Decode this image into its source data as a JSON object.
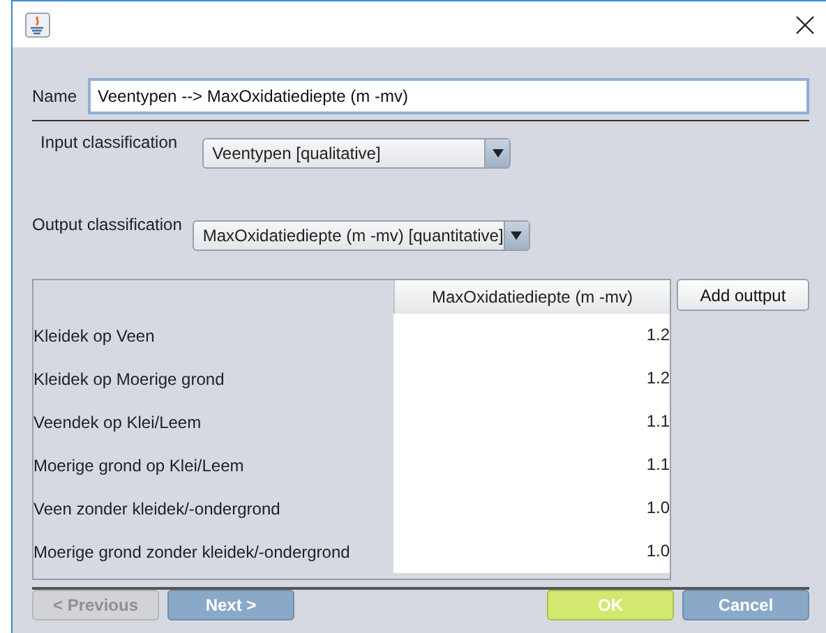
{
  "name_field": {
    "label": "Name",
    "value": "Veentypen --> MaxOxidatiediepte (m -mv)"
  },
  "input_classification": {
    "label": "Input classification",
    "value": "Veentypen [qualitative]"
  },
  "output_classification": {
    "label": "Output classification",
    "value": "MaxOxidatiediepte (m -mv) [quantitative]"
  },
  "table": {
    "columns": [
      "MaxOxidatiediepte (m -mv)"
    ],
    "rows": [
      {
        "label": "Kleidek op Veen",
        "value": "1.2"
      },
      {
        "label": "Kleidek op Moerige grond",
        "value": "1.2"
      },
      {
        "label": "Veendek op Klei/Leem",
        "value": "1.1"
      },
      {
        "label": "Moerige grond op Klei/Leem",
        "value": "1.1"
      },
      {
        "label": "Veen zonder kleidek/-ondergrond",
        "value": "1.0"
      },
      {
        "label": "Moerige grond zonder kleidek/-ondergrond",
        "value": "1.0"
      }
    ]
  },
  "add_output_button": "Add outtput",
  "buttons": [
    {
      "label": "< Previous",
      "kind": "normal",
      "disabled": true
    },
    {
      "label": "Next >",
      "kind": "normal",
      "disabled": false
    },
    {
      "label": "OK",
      "kind": "default",
      "disabled": false
    },
    {
      "label": "Cancel",
      "kind": "normal",
      "disabled": false
    }
  ]
}
